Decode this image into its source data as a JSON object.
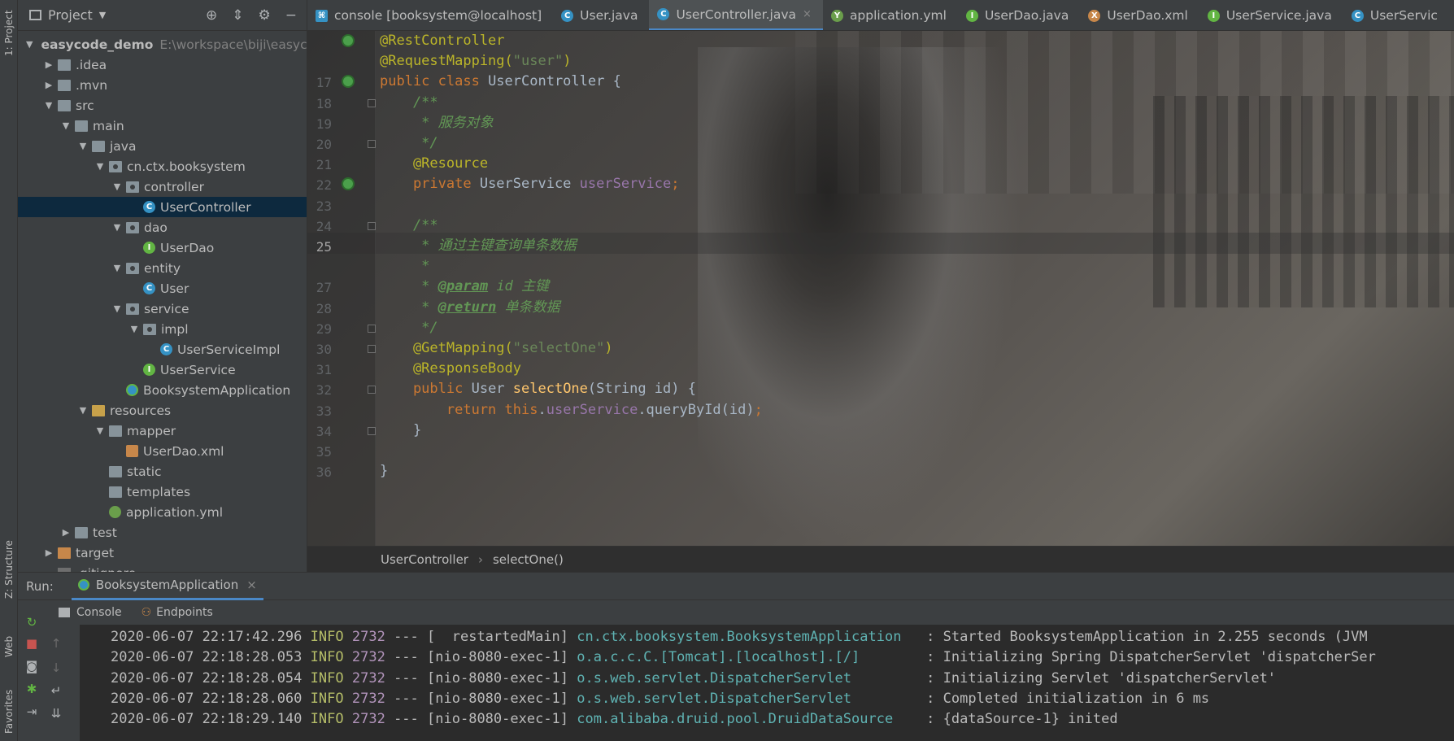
{
  "left_strip": {
    "project_tab": "1: Project",
    "structure_tab": "Z: Structure",
    "web_tab": "Web",
    "favorites_tab": "Favorites"
  },
  "project": {
    "title": "Project",
    "tree": [
      {
        "label": "easycode_demo",
        "path": "E:\\workspace\\biji\\easycode",
        "depth": 0,
        "icon": "folder",
        "arrow": "▼",
        "bold": true
      },
      {
        "label": ".idea",
        "depth": 1,
        "icon": "folder",
        "arrow": "▶"
      },
      {
        "label": ".mvn",
        "depth": 1,
        "icon": "folder",
        "arrow": "▶"
      },
      {
        "label": "src",
        "depth": 1,
        "icon": "folder",
        "arrow": "▼"
      },
      {
        "label": "main",
        "depth": 2,
        "icon": "folder",
        "arrow": "▼"
      },
      {
        "label": "java",
        "depth": 3,
        "icon": "folder",
        "arrow": "▼"
      },
      {
        "label": "cn.ctx.booksystem",
        "depth": 4,
        "icon": "pkg",
        "arrow": "▼"
      },
      {
        "label": "controller",
        "depth": 5,
        "icon": "pkg",
        "arrow": "▼"
      },
      {
        "label": "UserController",
        "depth": 6,
        "icon": "cls",
        "arrow": "",
        "selected": true
      },
      {
        "label": "dao",
        "depth": 5,
        "icon": "pkg",
        "arrow": "▼"
      },
      {
        "label": "UserDao",
        "depth": 6,
        "icon": "ifc",
        "arrow": ""
      },
      {
        "label": "entity",
        "depth": 5,
        "icon": "pkg",
        "arrow": "▼"
      },
      {
        "label": "User",
        "depth": 6,
        "icon": "cls",
        "arrow": ""
      },
      {
        "label": "service",
        "depth": 5,
        "icon": "pkg",
        "arrow": "▼"
      },
      {
        "label": "impl",
        "depth": 6,
        "icon": "pkg",
        "arrow": "▼"
      },
      {
        "label": "UserServiceImpl",
        "depth": 7,
        "icon": "cls",
        "arrow": ""
      },
      {
        "label": "UserService",
        "depth": 6,
        "icon": "ifc",
        "arrow": ""
      },
      {
        "label": "BooksystemApplication",
        "depth": 5,
        "icon": "boot",
        "arrow": ""
      },
      {
        "label": "resources",
        "depth": 3,
        "icon": "res",
        "arrow": "▼"
      },
      {
        "label": "mapper",
        "depth": 4,
        "icon": "folder",
        "arrow": "▼"
      },
      {
        "label": "UserDao.xml",
        "depth": 5,
        "icon": "xml",
        "arrow": ""
      },
      {
        "label": "static",
        "depth": 4,
        "icon": "folder",
        "arrow": ""
      },
      {
        "label": "templates",
        "depth": 4,
        "icon": "folder",
        "arrow": ""
      },
      {
        "label": "application.yml",
        "depth": 4,
        "icon": "yml",
        "arrow": ""
      },
      {
        "label": "test",
        "depth": 2,
        "icon": "folder",
        "arrow": "▶"
      },
      {
        "label": "target",
        "depth": 1,
        "icon": "folder-orange",
        "arrow": "▶"
      },
      {
        "label": ".gitignore",
        "depth": 1,
        "icon": "file",
        "arrow": ""
      }
    ]
  },
  "tabs": [
    {
      "label": "console [booksystem@localhost]",
      "icon": "console",
      "color": "#3592c4"
    },
    {
      "label": "User.java",
      "icon": "C",
      "color": "#3592c4"
    },
    {
      "label": "UserController.java",
      "icon": "C",
      "color": "#3592c4",
      "active": true
    },
    {
      "label": "application.yml",
      "icon": "Y",
      "color": "#6a9e4b"
    },
    {
      "label": "UserDao.java",
      "icon": "I",
      "color": "#62b543"
    },
    {
      "label": "UserDao.xml",
      "icon": "X",
      "color": "#c7874a"
    },
    {
      "label": "UserService.java",
      "icon": "I",
      "color": "#62b543"
    },
    {
      "label": "UserServic",
      "icon": "C",
      "color": "#3592c4"
    }
  ],
  "editor": {
    "line_numbers": [
      "",
      "",
      "17",
      "18",
      "19",
      "20",
      "21",
      "22",
      "23",
      "24",
      "25",
      "",
      "27",
      "28",
      "29",
      "30",
      "31",
      "32",
      "33",
      "34",
      "35",
      "36"
    ],
    "current_line": "25",
    "lines": [
      [
        {
          "t": "@RestController",
          "c": "a"
        }
      ],
      [
        {
          "t": "@RequestMapping(",
          "c": "a"
        },
        {
          "t": "\"user\"",
          "c": "s"
        },
        {
          "t": ")",
          "c": "a"
        }
      ],
      [
        {
          "t": "public class ",
          "c": "k"
        },
        {
          "t": "UserController {",
          "c": "p"
        }
      ],
      [
        {
          "t": "    /**",
          "c": "c"
        }
      ],
      [
        {
          "t": "     * 服务对象",
          "c": "c"
        }
      ],
      [
        {
          "t": "     */",
          "c": "c"
        }
      ],
      [
        {
          "t": "    @Resource",
          "c": "a"
        }
      ],
      [
        {
          "t": "    private ",
          "c": "k"
        },
        {
          "t": "UserService ",
          "c": "p"
        },
        {
          "t": "userService",
          "c": "f"
        },
        {
          "t": ";",
          "c": "k"
        }
      ],
      [
        {
          "t": "",
          "c": "p"
        }
      ],
      [
        {
          "t": "    /**",
          "c": "c"
        }
      ],
      [
        {
          "t": "     * 通过主键查询单条数据",
          "c": "c"
        }
      ],
      [
        {
          "t": "     *",
          "c": "c"
        }
      ],
      [
        {
          "t": "     * ",
          "c": "c"
        },
        {
          "t": "@param",
          "c": "t"
        },
        {
          "t": " id 主键",
          "c": "c"
        }
      ],
      [
        {
          "t": "     * ",
          "c": "c"
        },
        {
          "t": "@return",
          "c": "t"
        },
        {
          "t": " 单条数据",
          "c": "c"
        }
      ],
      [
        {
          "t": "     */",
          "c": "c"
        }
      ],
      [
        {
          "t": "    @GetMapping(",
          "c": "a"
        },
        {
          "t": "\"selectOne\"",
          "c": "s"
        },
        {
          "t": ")",
          "c": "a"
        }
      ],
      [
        {
          "t": "    @ResponseBody",
          "c": "a"
        }
      ],
      [
        {
          "t": "    public ",
          "c": "k"
        },
        {
          "t": "User ",
          "c": "p"
        },
        {
          "t": "selectOne",
          "c": "m"
        },
        {
          "t": "(String id) {",
          "c": "p"
        }
      ],
      [
        {
          "t": "        return this",
          "c": "k"
        },
        {
          "t": ".",
          "c": "p"
        },
        {
          "t": "userService",
          "c": "f"
        },
        {
          "t": ".queryById(id)",
          "c": "p"
        },
        {
          "t": ";",
          "c": "k"
        }
      ],
      [
        {
          "t": "    }",
          "c": "p"
        }
      ],
      [
        {
          "t": "",
          "c": "p"
        }
      ],
      [
        {
          "t": "}",
          "c": "p"
        }
      ]
    ]
  },
  "breadcrumb": [
    "UserController",
    "selectOne()"
  ],
  "run": {
    "label": "Run:",
    "config": "BooksystemApplication",
    "subtabs": [
      "Console",
      "Endpoints"
    ],
    "logs": [
      {
        "ts": "2020-06-07 22:17:42.296",
        "level": "INFO",
        "pid": "2732",
        "sep": "---",
        "thread": "[  restartedMain]",
        "logger": "cn.ctx.booksystem.BooksystemApplication  ",
        "msg": ": Started BooksystemApplication in 2.255 seconds (JVM"
      },
      {
        "ts": "2020-06-07 22:18:28.053",
        "level": "INFO",
        "pid": "2732",
        "sep": "---",
        "thread": "[nio-8080-exec-1]",
        "logger": "o.a.c.c.C.[Tomcat].[localhost].[/]       ",
        "msg": ": Initializing Spring DispatcherServlet 'dispatcherSer"
      },
      {
        "ts": "2020-06-07 22:18:28.054",
        "level": "INFO",
        "pid": "2732",
        "sep": "---",
        "thread": "[nio-8080-exec-1]",
        "logger": "o.s.web.servlet.DispatcherServlet        ",
        "msg": ": Initializing Servlet 'dispatcherServlet'"
      },
      {
        "ts": "2020-06-07 22:18:28.060",
        "level": "INFO",
        "pid": "2732",
        "sep": "---",
        "thread": "[nio-8080-exec-1]",
        "logger": "o.s.web.servlet.DispatcherServlet        ",
        "msg": ": Completed initialization in 6 ms"
      },
      {
        "ts": "2020-06-07 22:18:29.140",
        "level": "INFO",
        "pid": "2732",
        "sep": "---",
        "thread": "[nio-8080-exec-1]",
        "logger": "com.alibaba.druid.pool.DruidDataSource   ",
        "msg": ": {dataSource-1} inited"
      }
    ]
  }
}
